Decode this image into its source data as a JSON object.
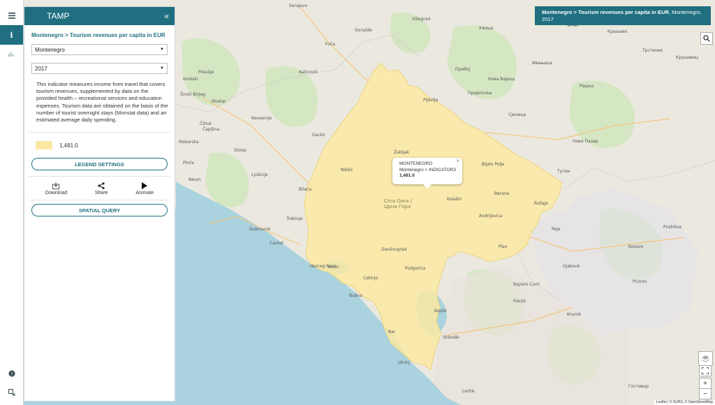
{
  "app": {
    "title": "TAMP"
  },
  "sidebar": {
    "breadcrumb": "Montenegro > Tourism revenues per capita in EUR",
    "country_select": "Montenegro",
    "year_select": "2017",
    "description": "This indicator measures income from travel that covers tourism revenues, supplemented by data on the provided health – recreational services and education expenses. Tourism data are obtained on the basis of the number of tourist overnight stays (Monstat data) and an estimated average daily spending.",
    "legend": {
      "value": "1,481.0",
      "color": "#fbe9a3"
    },
    "legend_settings_label": "LEGEND SETTINGS",
    "actions": {
      "download": "Download",
      "share": "Share",
      "animate": "Animate"
    },
    "spatial_query_label": "SPATIAL QUERY"
  },
  "rail": {
    "icons": [
      "layers-icon",
      "info-icon",
      "chart-icon",
      "help-icon",
      "export-icon"
    ]
  },
  "popup": {
    "title": "MONTENEGRO",
    "subtitle": "Montenegro > INDICATOR3",
    "value": "1,481.0"
  },
  "info_box": {
    "bold": "Montenegro > Tourism revenues per capita in EUR",
    "rest": ", Montenegro, 2017"
  },
  "map": {
    "attribution": "Leaflet | © SURS, © OpenStreetMap",
    "places": [
      {
        "t": "Sarajevo"
      },
      {
        "t": "Višegrad"
      },
      {
        "t": "Goražde"
      },
      {
        "t": "Foča"
      },
      {
        "t": "Mostar"
      },
      {
        "t": "Čapljina"
      },
      {
        "t": "Trebinje"
      },
      {
        "t": "Dubrovnik"
      },
      {
        "t": "Cavtat"
      },
      {
        "t": "Nevesinje"
      },
      {
        "t": "Gacko"
      },
      {
        "t": "Bileća"
      },
      {
        "t": "Ljubinje"
      },
      {
        "t": "Stolac"
      },
      {
        "t": "Kalinovik"
      },
      {
        "t": "Neum"
      },
      {
        "t": "Ploče"
      },
      {
        "t": "Makarska"
      },
      {
        "t": "Imotski"
      },
      {
        "t": "Posušje"
      },
      {
        "t": "Široki Brijeg"
      },
      {
        "t": "Čitluk"
      },
      {
        "t": "Nikšić"
      },
      {
        "t": "Podgorica"
      },
      {
        "t": "Danilovgrad"
      },
      {
        "t": "Kotor"
      },
      {
        "t": "Herceg Novi"
      },
      {
        "t": "Cetinje"
      },
      {
        "t": "Budva"
      },
      {
        "t": "Bar"
      },
      {
        "t": "Ulcinj"
      },
      {
        "t": "Pljevlja"
      },
      {
        "t": "Žabljak"
      },
      {
        "t": "Kolašin"
      },
      {
        "t": "Berane"
      },
      {
        "t": "Andrijevica"
      },
      {
        "t": "Plav"
      },
      {
        "t": "Bijelo Polje"
      },
      {
        "t": "Rožaje"
      },
      {
        "t": "Shkodër"
      },
      {
        "t": "Lezhë"
      },
      {
        "t": "Peje"
      },
      {
        "t": "Prishtine"
      },
      {
        "t": "Kosovo"
      },
      {
        "t": "Нови Пазар"
      },
      {
        "t": "Краљево"
      },
      {
        "t": "Трстеник"
      },
      {
        "t": "Крушевац"
      },
      {
        "t": "Сјеница"
      },
      {
        "t": "Нова Варош"
      },
      {
        "t": "Прибој"
      },
      {
        "t": "Пријепоље"
      },
      {
        "t": "Ужице"
      },
      {
        "t": "Чачак"
      },
      {
        "t": "Ивањица"
      },
      {
        "t": "Рашка"
      },
      {
        "t": "Тутин"
      },
      {
        "t": "Гостивар"
      },
      {
        "t": "Fierzë"
      },
      {
        "t": "Krumë"
      },
      {
        "t": "Bajram Curri"
      },
      {
        "t": "Gjakovë"
      },
      {
        "t": "Prizren"
      },
      {
        "t": "Koplik"
      },
      {
        "t": "Crna Gora / Црна Гора"
      }
    ]
  }
}
